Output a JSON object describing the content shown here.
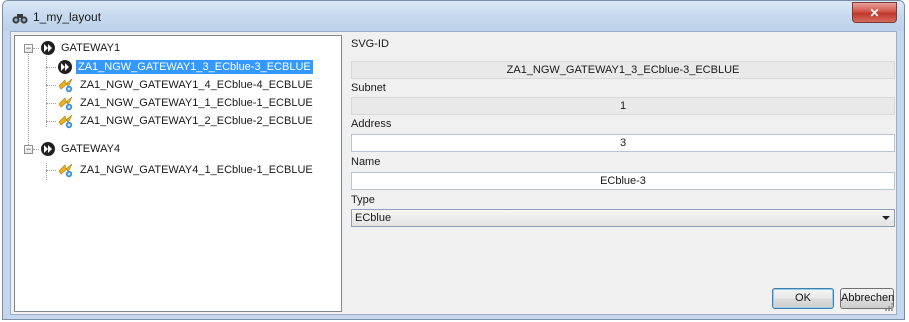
{
  "window": {
    "title": "1_my_layout",
    "close_glyph": "✕"
  },
  "icons": {
    "app": "binoculars-icon",
    "gateway": "gateway-forward-icon",
    "device": "device-plug-icon"
  },
  "tree": {
    "gateways": [
      {
        "label": "GATEWAY1",
        "expander": "−",
        "children": [
          {
            "label": "ZA1_NGW_GATEWAY1_3_ECblue-3_ECBLUE",
            "selected": true
          },
          {
            "label": "ZA1_NGW_GATEWAY1_4_ECblue-4_ECBLUE"
          },
          {
            "label": "ZA1_NGW_GATEWAY1_1_ECblue-1_ECBLUE"
          },
          {
            "label": "ZA1_NGW_GATEWAY1_2_ECblue-2_ECBLUE"
          }
        ]
      },
      {
        "label": "GATEWAY4",
        "expander": "−",
        "children": [
          {
            "label": "ZA1_NGW_GATEWAY4_1_ECblue-1_ECBLUE"
          }
        ]
      }
    ]
  },
  "properties": {
    "svg_id": {
      "label": "SVG-ID",
      "value": "ZA1_NGW_GATEWAY1_3_ECblue-3_ECBLUE"
    },
    "subnet": {
      "label": "Subnet",
      "value": "1"
    },
    "address": {
      "label": "Address",
      "value": "3"
    },
    "name": {
      "label": "Name",
      "value": "ECblue-3"
    },
    "type": {
      "label": "Type",
      "value": "ECblue"
    }
  },
  "buttons": {
    "ok": "OK",
    "cancel": "Abbrechen"
  },
  "colors": {
    "selection": "#3399ff",
    "titlebar": "#c7d9ee",
    "close": "#c0382c"
  }
}
